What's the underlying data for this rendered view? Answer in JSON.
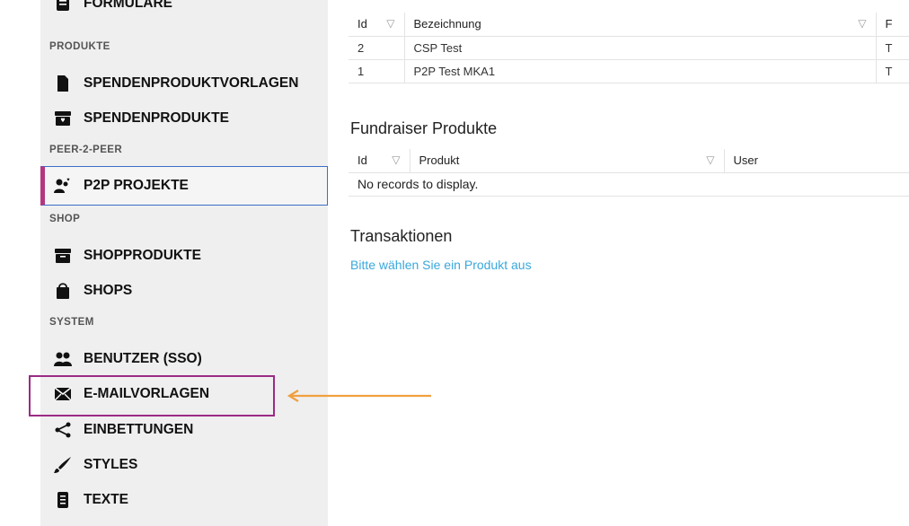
{
  "sidebar": {
    "top_partial": "FORMULARE",
    "sections": {
      "produkte": "PRODUKTE",
      "p2p": "PEER-2-PEER",
      "shop": "SHOP",
      "system": "SYSTEM"
    },
    "items": {
      "spendenproduktvorlagen": "SPENDENPRODUKTVORLAGEN",
      "spendenprodukte": "SPENDENPRODUKTE",
      "p2p_projekte": "P2P PROJEKTE",
      "shopprodukte": "SHOPPRODUKTE",
      "shops": "SHOPS",
      "benutzer": "BENUTZER (SSO)",
      "emailvorlagen": "E-MAILVORLAGEN",
      "einbettungen": "EINBETTUNGEN",
      "styles": "STYLES",
      "texte": "TEXTE"
    }
  },
  "main": {
    "table1": {
      "headers": {
        "id": "Id",
        "bezeichnung": "Bezeichnung",
        "next": "F"
      },
      "rows": [
        {
          "id": "2",
          "bezeichnung": "CSP Test",
          "next": "T"
        },
        {
          "id": "1",
          "bezeichnung": "P2P Test MKA1",
          "next": "T"
        }
      ]
    },
    "fundraiser_heading": "Fundraiser Produkte",
    "table2": {
      "headers": {
        "id": "Id",
        "produkt": "Produkt",
        "user": "User"
      },
      "empty": "No records to display."
    },
    "transaktionen_heading": "Transaktionen",
    "select_prompt": "Bitte wählen Sie ein Produkt aus"
  },
  "annotation": {
    "box_color": "#9b2b84",
    "arrow_color": "#f0a040"
  },
  "colors": {
    "active_accent": "#b3377f",
    "link": "#3aa8dc"
  }
}
